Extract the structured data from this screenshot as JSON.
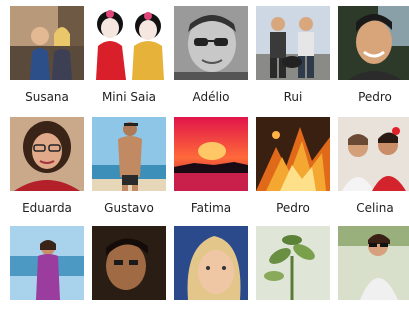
{
  "friends": [
    {
      "name": "Susana",
      "photo": "couple-indoor-photo"
    },
    {
      "name": "Mini Saia",
      "photo": "cartoon-betty-boop-photo"
    },
    {
      "name": "Adélio",
      "photo": "man-sunglasses-bw-photo"
    },
    {
      "name": "Rui",
      "photo": "two-men-with-dog-photo"
    },
    {
      "name": "Pedro",
      "photo": "man-smiling-outdoor-photo"
    },
    {
      "name": "Eduarda",
      "photo": "woman-red-top-glasses-photo"
    },
    {
      "name": "Gustavo",
      "photo": "shirtless-man-beach-photo"
    },
    {
      "name": "Fatima",
      "photo": "red-sunset-sea-photo"
    },
    {
      "name": "Pedro",
      "photo": "fire-dragon-art-photo"
    },
    {
      "name": "Celina",
      "photo": "two-women-party-photo"
    },
    {
      "name": "",
      "photo": "woman-purple-dress-beach-photo"
    },
    {
      "name": "",
      "photo": "man-dark-room-photo"
    },
    {
      "name": "",
      "photo": "woman-face-closeup-photo"
    },
    {
      "name": "",
      "photo": "plant-closeup-photo"
    },
    {
      "name": "",
      "photo": "woman-sunglasses-outdoor-photo"
    }
  ]
}
